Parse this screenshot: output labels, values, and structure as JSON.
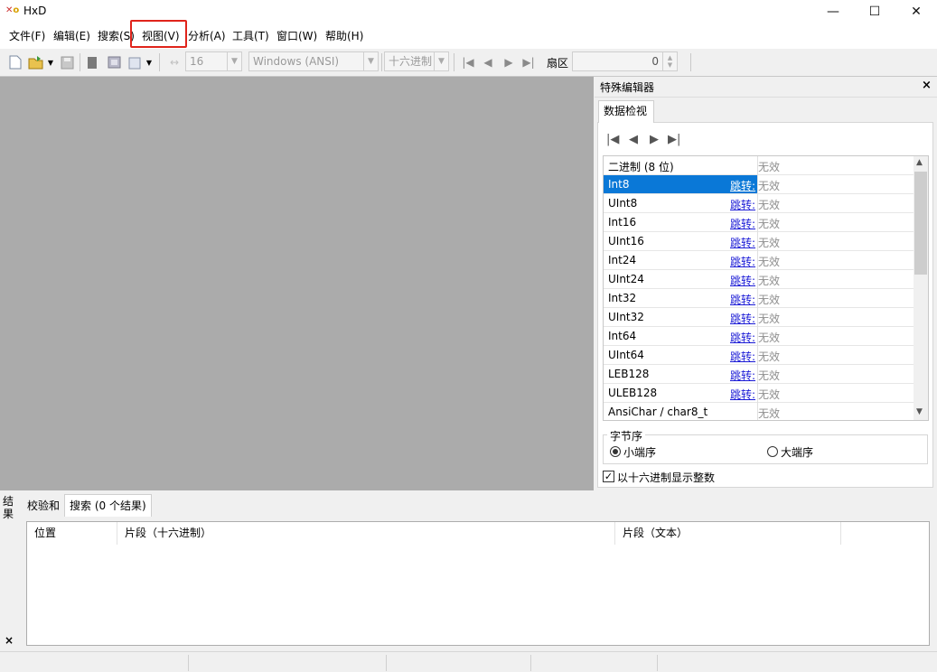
{
  "window": {
    "title": "HxD",
    "icon_label": "HxD",
    "minimize": "—",
    "maximize": "☐",
    "close": "✕"
  },
  "menu": {
    "items": [
      "文件(F)",
      "编辑(E)",
      "搜索(S)",
      "视图(V)",
      "分析(A)",
      "工具(T)",
      "窗口(W)",
      "帮助(H)"
    ],
    "highlighted": "视图(V)"
  },
  "toolbar": {
    "bytes_per_row": "16",
    "charset": "Windows (ANSI)",
    "offset_base": "十六进制",
    "sector_label": "扇区",
    "sector_value": "0"
  },
  "special_editor": {
    "title": "特殊编辑器",
    "close": "×",
    "tab": "数据检视",
    "rows": [
      {
        "name": "二进制 (8 位)",
        "jump": "",
        "value": "无效"
      },
      {
        "name": "Int8",
        "jump": "跳转:",
        "value": "无效"
      },
      {
        "name": "UInt8",
        "jump": "跳转:",
        "value": "无效"
      },
      {
        "name": "Int16",
        "jump": "跳转:",
        "value": "无效"
      },
      {
        "name": "UInt16",
        "jump": "跳转:",
        "value": "无效"
      },
      {
        "name": "Int24",
        "jump": "跳转:",
        "value": "无效"
      },
      {
        "name": "UInt24",
        "jump": "跳转:",
        "value": "无效"
      },
      {
        "name": "Int32",
        "jump": "跳转:",
        "value": "无效"
      },
      {
        "name": "UInt32",
        "jump": "跳转:",
        "value": "无效"
      },
      {
        "name": "Int64",
        "jump": "跳转:",
        "value": "无效"
      },
      {
        "name": "UInt64",
        "jump": "跳转:",
        "value": "无效"
      },
      {
        "name": "LEB128",
        "jump": "跳转:",
        "value": "无效"
      },
      {
        "name": "ULEB128",
        "jump": "跳转:",
        "value": "无效"
      },
      {
        "name": "AnsiChar / char8_t",
        "jump": "",
        "value": "无效"
      }
    ],
    "selected_row": "Int8",
    "byte_order": {
      "label": "字节序",
      "little_endian": "小端序",
      "big_endian": "大端序",
      "selected": "小端序"
    },
    "hex_integers": {
      "label": "以十六进制显示整数",
      "checked": true
    }
  },
  "results": {
    "side_label": "结果",
    "tabs": [
      "校验和",
      "搜索 (0 个结果)"
    ],
    "active_tab": "搜索 (0 个结果)",
    "columns": [
      "位置",
      "片段（十六进制）",
      "片段（文本）"
    ],
    "close": "×"
  },
  "colors": {
    "accent": "#0a78d7",
    "highlight_box": "#e0241b",
    "editor_bg": "#ababab"
  }
}
